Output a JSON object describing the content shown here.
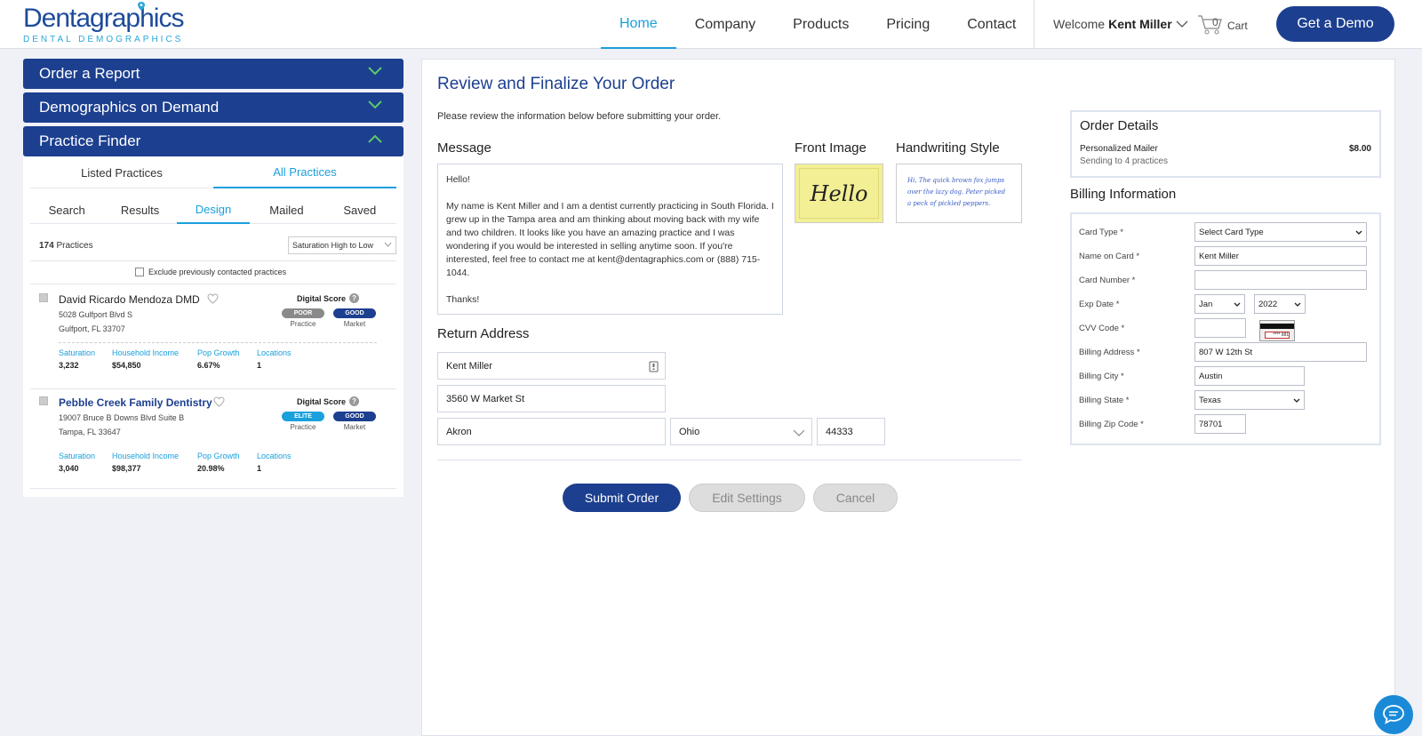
{
  "header": {
    "logo_main": "Dentagraphics",
    "logo_sub": "DENTAL DEMOGRAPHICS",
    "nav": [
      "Home",
      "Company",
      "Products",
      "Pricing",
      "Contact"
    ],
    "active_nav": "Home",
    "welcome_label": "Welcome",
    "user_name": "Kent Miller",
    "cart_count": "0",
    "cart_label": "Cart",
    "demo_button": "Get a Demo"
  },
  "sidebar": {
    "accordions": [
      "Order a Report",
      "Demographics on Demand",
      "Practice Finder"
    ],
    "tabs_primary": [
      "Listed Practices",
      "All Practices"
    ],
    "tabs_secondary": [
      "Search",
      "Results",
      "Design",
      "Mailed",
      "Saved"
    ],
    "practice_count": "174",
    "practice_count_label": "Practices",
    "sort_selected": "Saturation High to Low",
    "exclude_label": "Exclude previously contacted practices",
    "practices": [
      {
        "name": "David Ricardo Mendoza DMD",
        "address1": "5028 Gulfport Blvd S",
        "address2": "Gulfport, FL 33707",
        "score_label": "Digital Score",
        "practice_badge": "POOR",
        "market_badge": "GOOD",
        "practice_lbl": "Practice",
        "market_lbl": "Market",
        "stats": [
          {
            "label": "Saturation",
            "value": "3,232"
          },
          {
            "label": "Household Income",
            "value": "$54,850"
          },
          {
            "label": "Pop Growth",
            "value": "6.67%"
          },
          {
            "label": "Locations",
            "value": "1"
          }
        ]
      },
      {
        "name": "Pebble Creek Family Dentistry",
        "address1": "19007 Bruce B Downs Blvd Suite B",
        "address2": "Tampa, FL 33647",
        "score_label": "Digital Score",
        "practice_badge": "ELITE",
        "market_badge": "GOOD",
        "practice_lbl": "Practice",
        "market_lbl": "Market",
        "stats": [
          {
            "label": "Saturation",
            "value": "3,040"
          },
          {
            "label": "Household Income",
            "value": "$98,377"
          },
          {
            "label": "Pop Growth",
            "value": "20.98%"
          },
          {
            "label": "Locations",
            "value": "1"
          }
        ]
      }
    ]
  },
  "main": {
    "title": "Review and Finalize Your Order",
    "instructions": "Please review the information below before submitting your order.",
    "message_heading": "Message",
    "front_image_heading": "Front Image",
    "handwriting_heading": "Handwriting Style",
    "message": {
      "greeting": "Hello!",
      "body": "My name is Kent Miller and I am a dentist currently practicing in South Florida. I grew up in the Tampa area and am thinking about moving back with my wife and two children. It looks like you have an amazing practice and I was wondering if you would be interested in selling anytime soon. If you're interested, feel free to contact me at kent@dentagraphics.com or (888) 715-1044.",
      "closing": "Thanks!"
    },
    "front_image_text": "Hello",
    "handwriting_sample": "Hi, The quick brown fox jumps over the lazy dog. Peter picked a peck of pickled peppers.",
    "return_heading": "Return Address",
    "return_name": "Kent Miller",
    "return_street": "3560 W Market St",
    "return_city": "Akron",
    "return_state": "Ohio",
    "return_zip": "44333",
    "submit": "Submit Order",
    "edit": "Edit Settings",
    "cancel": "Cancel"
  },
  "order": {
    "title": "Order Details",
    "item": "Personalized Mailer",
    "price": "$8.00",
    "sub": "Sending to 4 practices"
  },
  "billing": {
    "title": "Billing Information",
    "labels": [
      "Card Type *",
      "Name on Card *",
      "Card Number *",
      "Exp Date *",
      "CVV Code *",
      "Billing Address *",
      "Billing City *",
      "Billing State *",
      "Billing Zip Code *"
    ],
    "card_type": "Select Card Type",
    "name_on_card": "Kent Miller",
    "card_number": "",
    "exp_month": "Jan",
    "exp_year": "2022",
    "cvv": "",
    "cvv_sample": "**** 981",
    "address": "807 W 12th St",
    "city": "Austin",
    "state": "Texas",
    "zip": "78701"
  },
  "colors": {
    "brand": "#1c3f8f",
    "accent": "#1aa0dc",
    "badge_poor": "#8a8a8a",
    "badge_good": "#1c3f8f",
    "badge_elite": "#1aa0dc"
  }
}
